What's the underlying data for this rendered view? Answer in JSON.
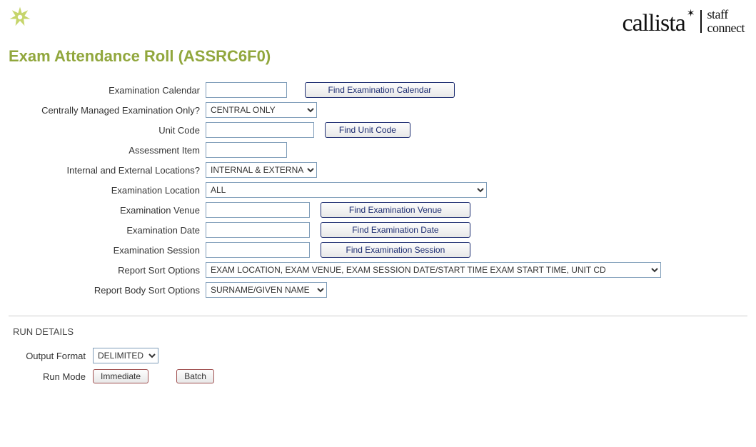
{
  "brand": {
    "callista": "callista",
    "staff": "staff",
    "connect": "connect"
  },
  "page_title": "Exam Attendance Roll (ASSRC6F0)",
  "form": {
    "exam_calendar": {
      "label": "Examination Calendar",
      "value": "",
      "button": "Find Examination Calendar"
    },
    "central_only": {
      "label": "Centrally Managed Examination Only?",
      "value": "CENTRAL ONLY"
    },
    "unit_code": {
      "label": "Unit Code",
      "value": "",
      "button": "Find Unit Code"
    },
    "assessment_item": {
      "label": "Assessment Item",
      "value": ""
    },
    "int_ext": {
      "label": "Internal and External Locations?",
      "value": "INTERNAL & EXTERNAL"
    },
    "exam_location": {
      "label": "Examination Location",
      "value": "ALL"
    },
    "exam_venue": {
      "label": "Examination Venue",
      "value": "",
      "button": "Find Examination Venue"
    },
    "exam_date": {
      "label": "Examination Date",
      "value": "",
      "button": "Find Examination Date"
    },
    "exam_session": {
      "label": "Examination Session",
      "value": "",
      "button": "Find Examination Session"
    },
    "report_sort": {
      "label": "Report Sort Options",
      "value": "EXAM LOCATION, EXAM VENUE, EXAM SESSION DATE/START TIME EXAM START TIME, UNIT CD"
    },
    "body_sort": {
      "label": "Report Body Sort Options",
      "value": "SURNAME/GIVEN NAME"
    }
  },
  "run": {
    "heading": "RUN DETAILS",
    "output_format": {
      "label": "Output Format",
      "value": "DELIMITED"
    },
    "run_mode": {
      "label": "Run Mode",
      "immediate": "Immediate",
      "batch": "Batch"
    }
  }
}
